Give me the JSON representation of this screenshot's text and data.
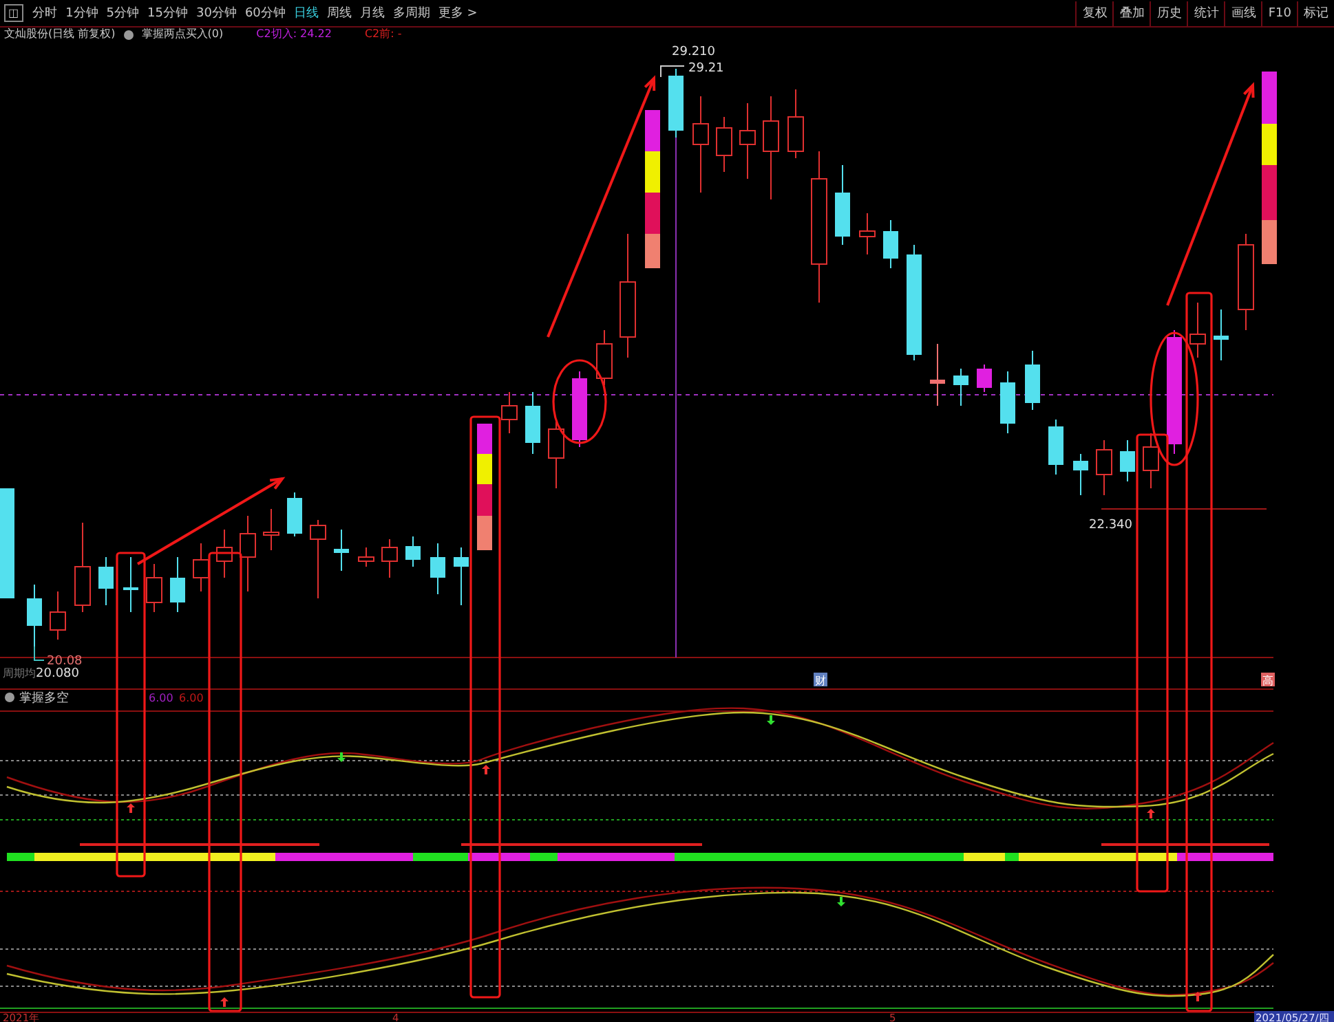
{
  "toolbar": {
    "toggle": "◫",
    "tabs": [
      {
        "label": "分时",
        "selected": false
      },
      {
        "label": "1分钟",
        "selected": false
      },
      {
        "label": "5分钟",
        "selected": false
      },
      {
        "label": "15分钟",
        "selected": false
      },
      {
        "label": "30分钟",
        "selected": false
      },
      {
        "label": "60分钟",
        "selected": false
      },
      {
        "label": "日线",
        "selected": true
      },
      {
        "label": "周线",
        "selected": false
      },
      {
        "label": "月线",
        "selected": false
      },
      {
        "label": "多周期",
        "selected": false
      },
      {
        "label": "更多 >",
        "selected": false
      }
    ],
    "buttons": [
      "复权",
      "叠加",
      "历史",
      "统计",
      "画线",
      "F10",
      "标记"
    ]
  },
  "main_panel": {
    "title": "文灿股份(日线 前复权)",
    "indicator": "掌握两点买入(0)",
    "readings": [
      {
        "text": "C2切入: 24.22",
        "color": "#c020e0"
      },
      {
        "text": "C2前: -",
        "color": "#e02020"
      }
    ],
    "price_labels": [
      "29.210",
      "29.21",
      "22.340",
      "20.08",
      "20.080"
    ],
    "side_label": "周期均",
    "event_marks": [
      {
        "text": "财",
        "color": "#6080c0"
      },
      {
        "text": "高",
        "color": "#e06060"
      }
    ]
  },
  "sub_panel": {
    "title": "掌握多空",
    "readings": [
      {
        "text": "6.00",
        "color": "#a020c0"
      },
      {
        "text": "6.00",
        "color": "#c01818"
      }
    ]
  },
  "time_axis": [
    "2021年",
    "4",
    "5",
    "2021/05/27/四"
  ]
}
